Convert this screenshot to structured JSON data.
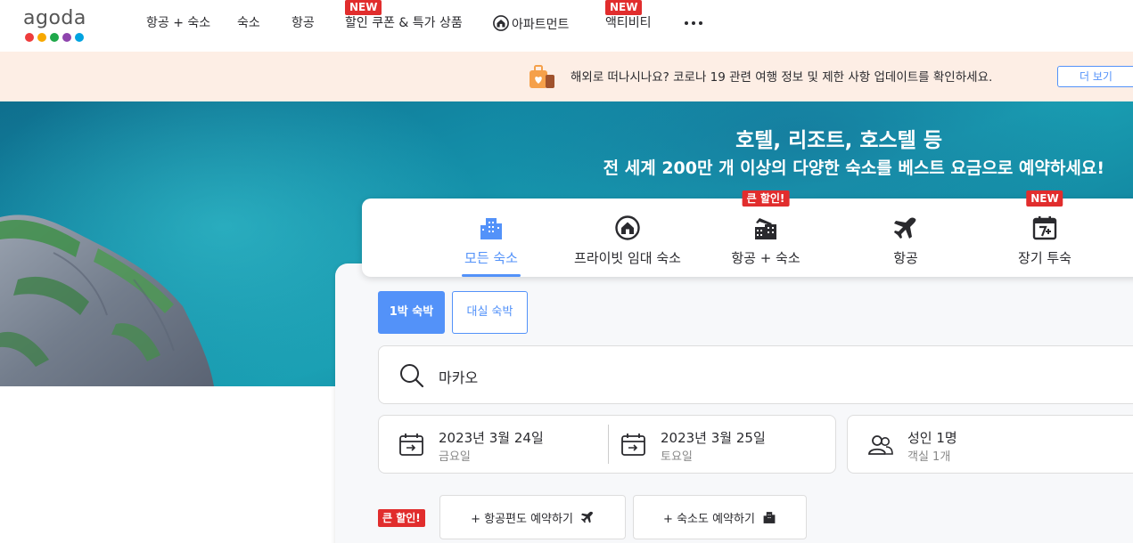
{
  "logo": {
    "text": "agoda",
    "dot_colors": [
      "#ee3c3c",
      "#f7a800",
      "#1fa84a",
      "#8e44ad",
      "#00a3e0"
    ]
  },
  "nav": {
    "items": [
      {
        "label": "항공 + 숙소"
      },
      {
        "label": "숙소"
      },
      {
        "label": "항공"
      },
      {
        "label": "할인 쿠폰 & 특가 상품",
        "badge": "NEW"
      },
      {
        "label": "아파트먼트"
      },
      {
        "label": "액티비티",
        "badge": "NEW"
      }
    ]
  },
  "banner": {
    "text": "해외로 떠나시나요? 코로나 19 관련 여행 정보 및 제한 사항 업데이트를 확인하세요.",
    "button": "더 보기"
  },
  "hero": {
    "title": "호텔, 리조트, 호스텔 등",
    "subtitle": "전 세계 200만 개 이상의 다양한 숙소를 베스트 요금으로 예약하세요!"
  },
  "tabs": [
    {
      "label": "모든 숙소",
      "icon": "hotel-building-icon",
      "active": true
    },
    {
      "label": "프라이빗 임대 숙소",
      "icon": "home-icon"
    },
    {
      "label": "항공 + 숙소",
      "icon": "flight-hotel-icon",
      "badge": "큰 할인!"
    },
    {
      "label": "항공",
      "icon": "airplane-icon"
    },
    {
      "label": "장기 투숙",
      "icon": "calendar-7plus-icon",
      "badge": "NEW"
    }
  ],
  "stay_type": {
    "overnight": "1박 숙박",
    "dayuse": "대실 숙박"
  },
  "search": {
    "value": "마카오"
  },
  "checkin": {
    "date": "2023년 3월 24일",
    "weekday": "금요일"
  },
  "checkout": {
    "date": "2023년 3월 25일",
    "weekday": "토요일"
  },
  "guests": {
    "main": "성인 1명",
    "sub": "객실 1개"
  },
  "addons": {
    "badge": "큰 할인!",
    "flight": "+ 항공편도 예약하기",
    "hotel": "+ 숙소도 예약하기"
  },
  "colors": {
    "accent": "#5392f9",
    "badge_red": "#e12d2d",
    "banner_bg": "#fdeee5"
  }
}
